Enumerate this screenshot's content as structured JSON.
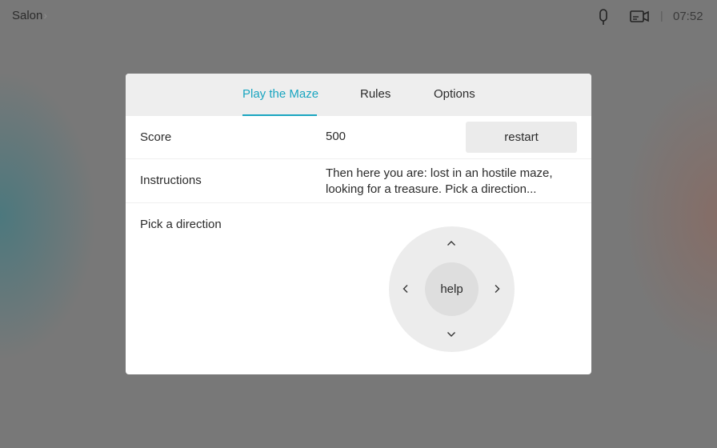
{
  "topbar": {
    "room_name": "Salon",
    "separator": "|",
    "time": "07:52",
    "icons": {
      "microphone": "microphone-icon",
      "camera": "camera-icon"
    }
  },
  "tabs": [
    {
      "label": "Play the Maze",
      "active": true
    },
    {
      "label": "Rules",
      "active": false
    },
    {
      "label": "Options",
      "active": false
    }
  ],
  "score": {
    "label": "Score",
    "value": "500",
    "restart_label": "restart"
  },
  "instructions": {
    "label": "Instructions",
    "text": "Then here you are: lost in an hostile maze, looking for a treasure. Pick a direction..."
  },
  "direction": {
    "label": "Pick a direction",
    "help_label": "help"
  },
  "colors": {
    "accent": "#19a5c0",
    "panel": "#ffffff",
    "header": "#eeeeee"
  }
}
